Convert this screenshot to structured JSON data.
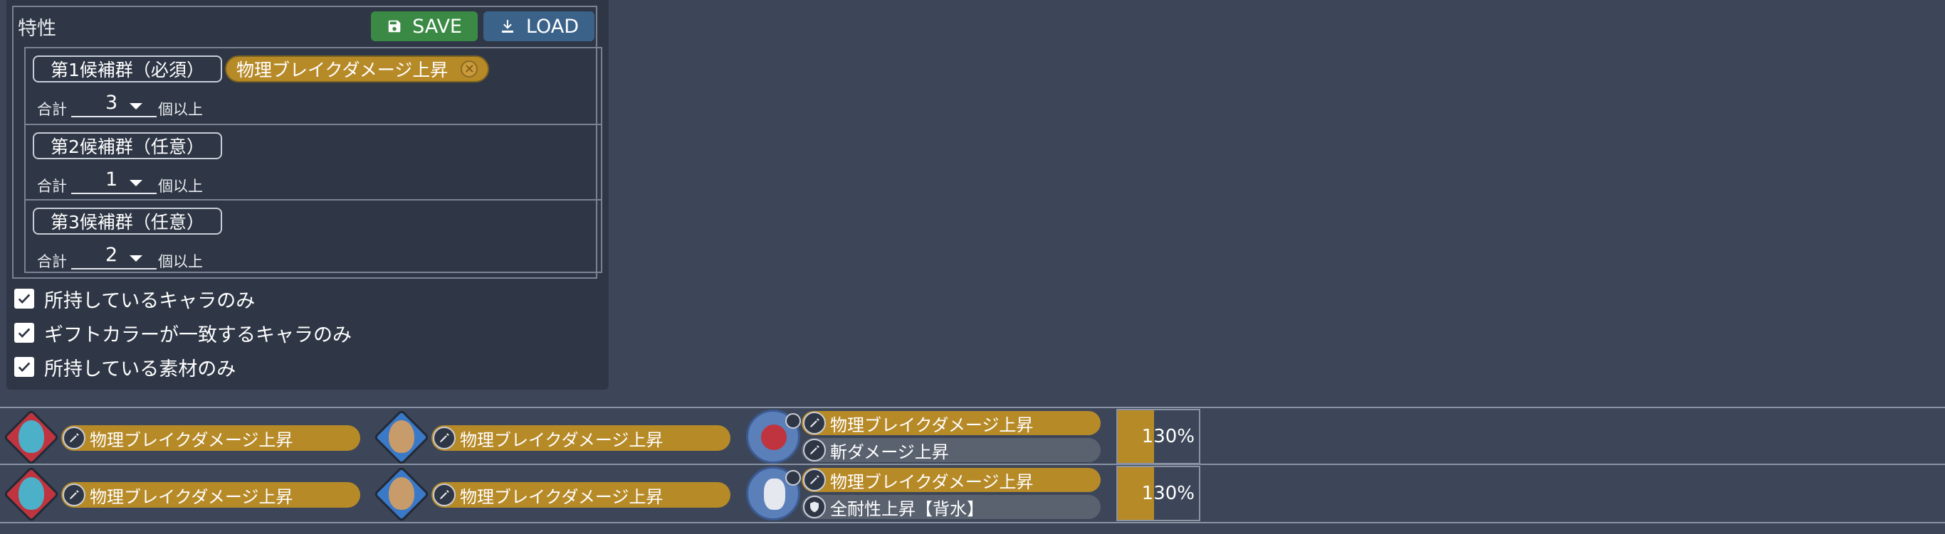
{
  "panel": {
    "title": "特性",
    "save_label": "SAVE",
    "load_label": "LOAD",
    "groups": [
      {
        "label": "第1候補群（必須）",
        "chip": "物理ブレイクダメージ上昇",
        "prefix": "合計",
        "count": "3",
        "suffix": "個以上"
      },
      {
        "label": "第2候補群（任意）",
        "prefix": "合計",
        "count": "1",
        "suffix": "個以上"
      },
      {
        "label": "第3候補群（任意）",
        "prefix": "合計",
        "count": "2",
        "suffix": "個以上"
      }
    ],
    "checks": [
      {
        "label": "所持しているキャラのみ",
        "checked": true
      },
      {
        "label": "ギフトカラーが一致するキャラのみ",
        "checked": true
      },
      {
        "label": "所持している素材のみ",
        "checked": true
      }
    ]
  },
  "results": [
    {
      "char1": {
        "skill": "物理ブレイクダメージ上昇",
        "color": "#c0343f"
      },
      "char2": {
        "skill": "物理ブレイクダメージ上昇",
        "color": "#3a78c8"
      },
      "memory": {
        "skill1": "物理ブレイクダメージ上昇",
        "skill2": "斬ダメージ上昇",
        "color": "#c0343f"
      },
      "percent": "130%",
      "percent_value": 0.45
    },
    {
      "char1": {
        "skill": "物理ブレイクダメージ上昇",
        "color": "#c0343f"
      },
      "char2": {
        "skill": "物理ブレイクダメージ上昇",
        "color": "#3a78c8"
      },
      "memory": {
        "skill1": "物理ブレイクダメージ上昇",
        "skill2": "全耐性上昇【背水】",
        "color": "#e6e8f0"
      },
      "percent": "130%",
      "percent_value": 0.45
    }
  ],
  "colors": {
    "background": "#3c4658",
    "panel": "#2f3746",
    "gold": "#b78a28",
    "save": "#3a8a45",
    "load": "#3b6289"
  }
}
